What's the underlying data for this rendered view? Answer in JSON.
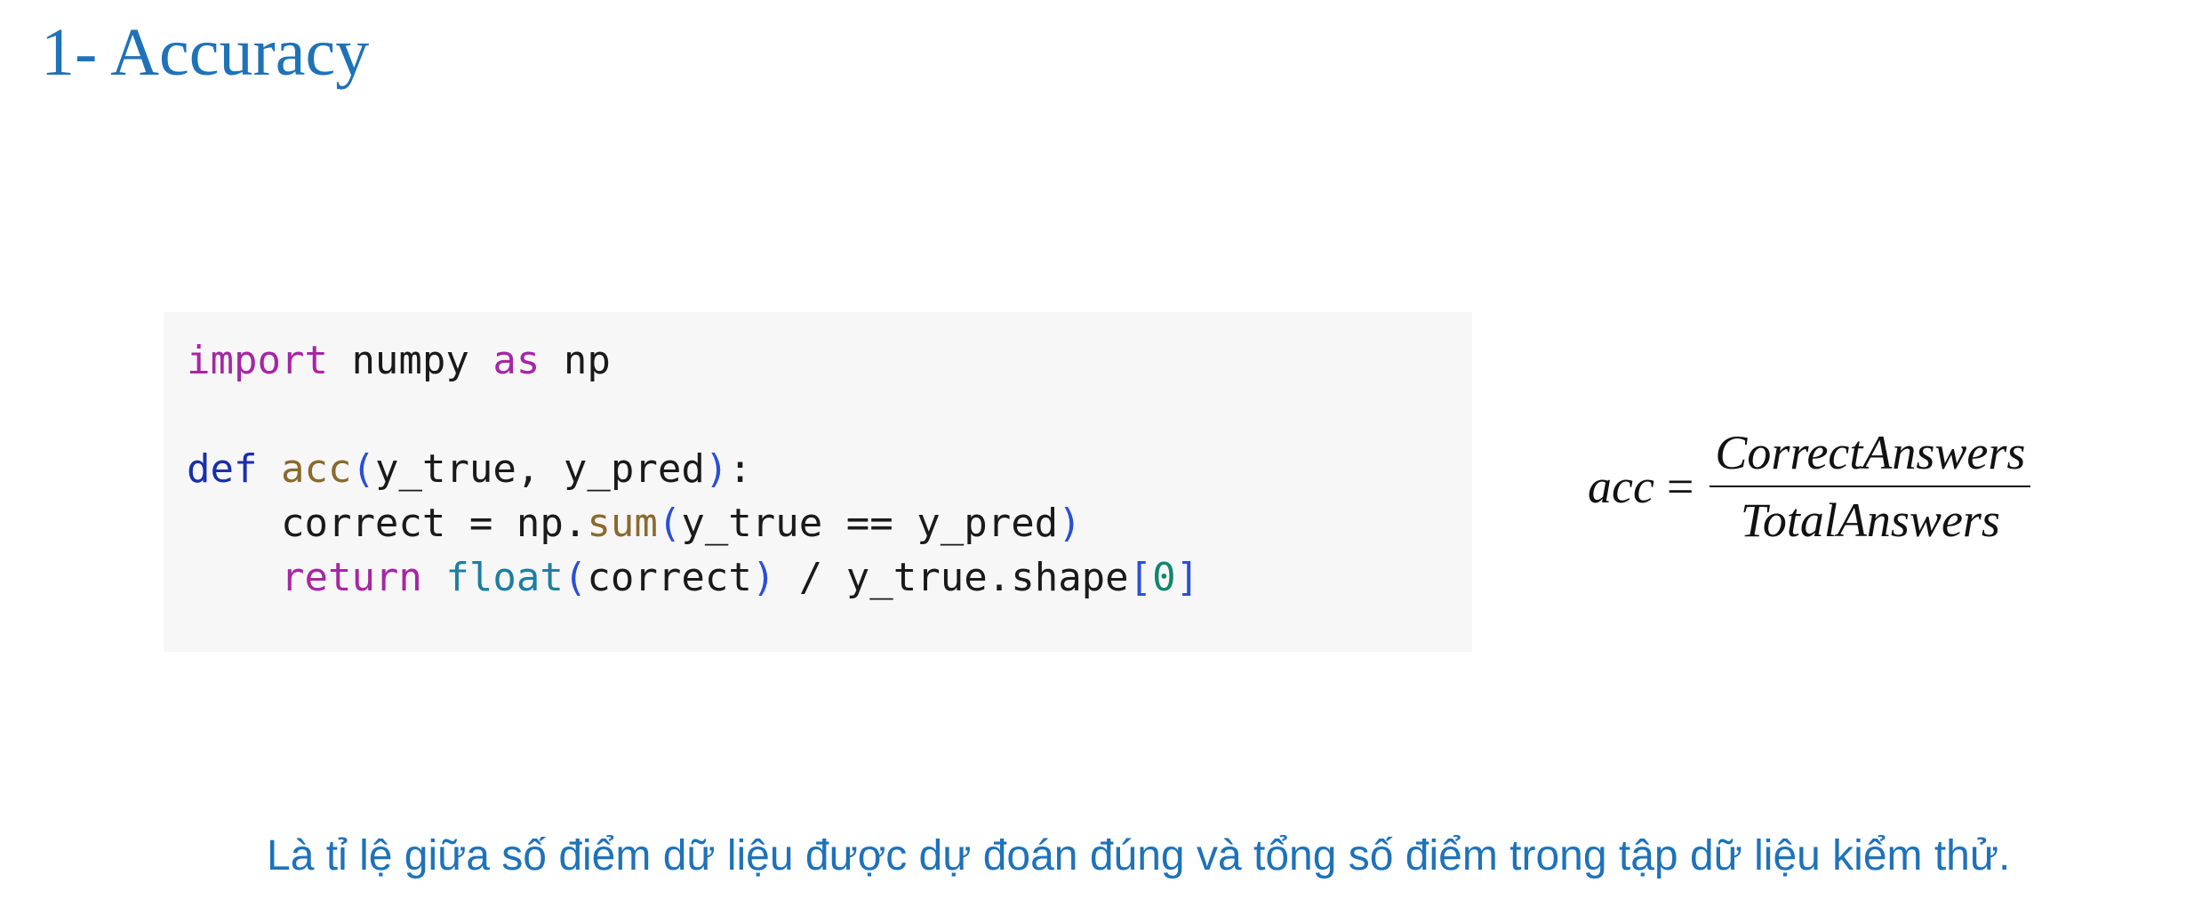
{
  "title": "1- Accuracy",
  "code": {
    "line1": {
      "import": "import",
      "module": " numpy ",
      "as": "as",
      "alias": " np"
    },
    "line3": {
      "def": "def",
      "name": "acc",
      "open": "(",
      "params": "y_true, y_pred",
      "close": ")",
      "colon": ":"
    },
    "line4": {
      "indent": "    ",
      "lhs": "correct = np.",
      "fn": "sum",
      "open": "(",
      "args": "y_true == y_pred",
      "close": ")"
    },
    "line5": {
      "indent": "    ",
      "return": "return",
      "sp": " ",
      "float": "float",
      "open": "(",
      "arg": "correct",
      "close": ")",
      "rest": " / y_true.shape",
      "lb": "[",
      "idx": "0",
      "rb": "]"
    }
  },
  "formula": {
    "lhs": "acc",
    "eq": "=",
    "numerator": "CorrectAnswers",
    "denominator": "TotalAnswers"
  },
  "caption": "Là tỉ lệ giữa số điểm dữ liệu được dự đoán đúng và tổng số điểm trong tập dữ liệu kiểm thử."
}
